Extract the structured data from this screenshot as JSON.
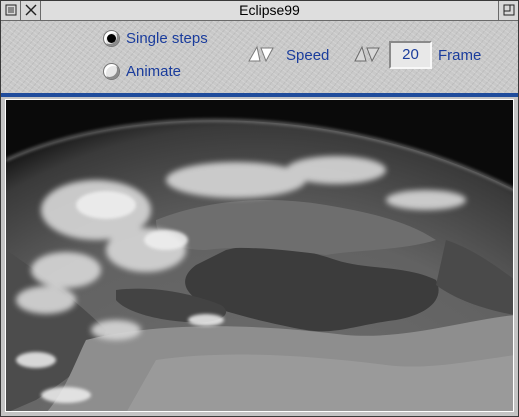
{
  "window": {
    "title": "Eclipse99"
  },
  "controls": {
    "mode_options": [
      {
        "label": "Single steps",
        "selected": true
      },
      {
        "label": "Animate",
        "selected": false
      }
    ],
    "speed_label": "Speed",
    "frame_label": "Frame",
    "frame_value": "20"
  },
  "icons": {
    "back": "back-icon",
    "close": "close-icon",
    "toggle_size": "toggle-size-icon",
    "speed_arrows": "up-down-arrows-icon",
    "frame_arrows": "up-down-arrows-icon"
  },
  "colors": {
    "label_text": "#1a3c9c",
    "divider": "#1f4c9c",
    "title_bar": "#dedede"
  },
  "image": {
    "description_name": "satellite-earth-view"
  }
}
